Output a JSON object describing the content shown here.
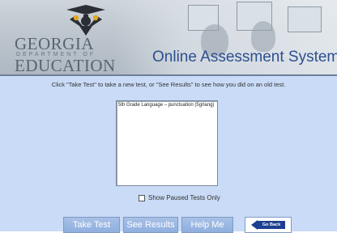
{
  "header": {
    "logo": {
      "line1": "GEORGIA",
      "line2": "DEPARTMENT OF",
      "line3": "EDUCATION"
    },
    "title": "Online Assessment System"
  },
  "main": {
    "instruction": "Click \"Take Test\" to take a new test, or \"See Results\" to see how you did on an old test.",
    "tests": [
      "5th Grade Language – punctuation (5grlang)"
    ],
    "paused_checkbox": {
      "label": "Show Paused Tests Only",
      "checked": false
    }
  },
  "buttons": {
    "take_test": "Take Test",
    "see_results": "See Results",
    "help_me": "Help Me",
    "go_back": "Go Back"
  },
  "colors": {
    "content_bg": "#c9dbf6",
    "title_blue": "#2c4f8f",
    "button_blue": "#8fafdf",
    "go_back_blue": "#1d3f8f"
  }
}
